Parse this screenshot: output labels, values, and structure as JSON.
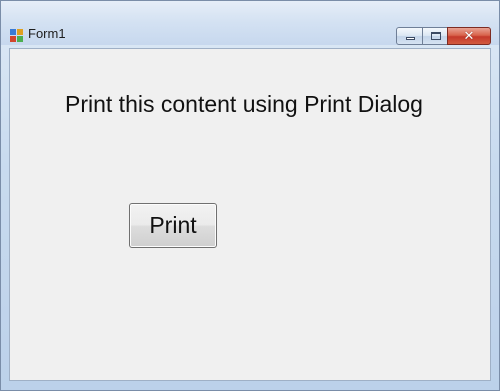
{
  "window": {
    "title": "Form1",
    "icon": "form-app-icon",
    "caption_buttons": {
      "minimize_icon": "minimize-icon",
      "maximize_icon": "maximize-icon",
      "close_icon": "close-icon",
      "close_glyph": "✕"
    }
  },
  "form": {
    "label_text": "Print this content using Print Dialog",
    "print_button_label": "Print"
  },
  "colors": {
    "close_button": "#c5392a",
    "client_background": "#f0f0f0",
    "frame": "#c9dbef"
  }
}
